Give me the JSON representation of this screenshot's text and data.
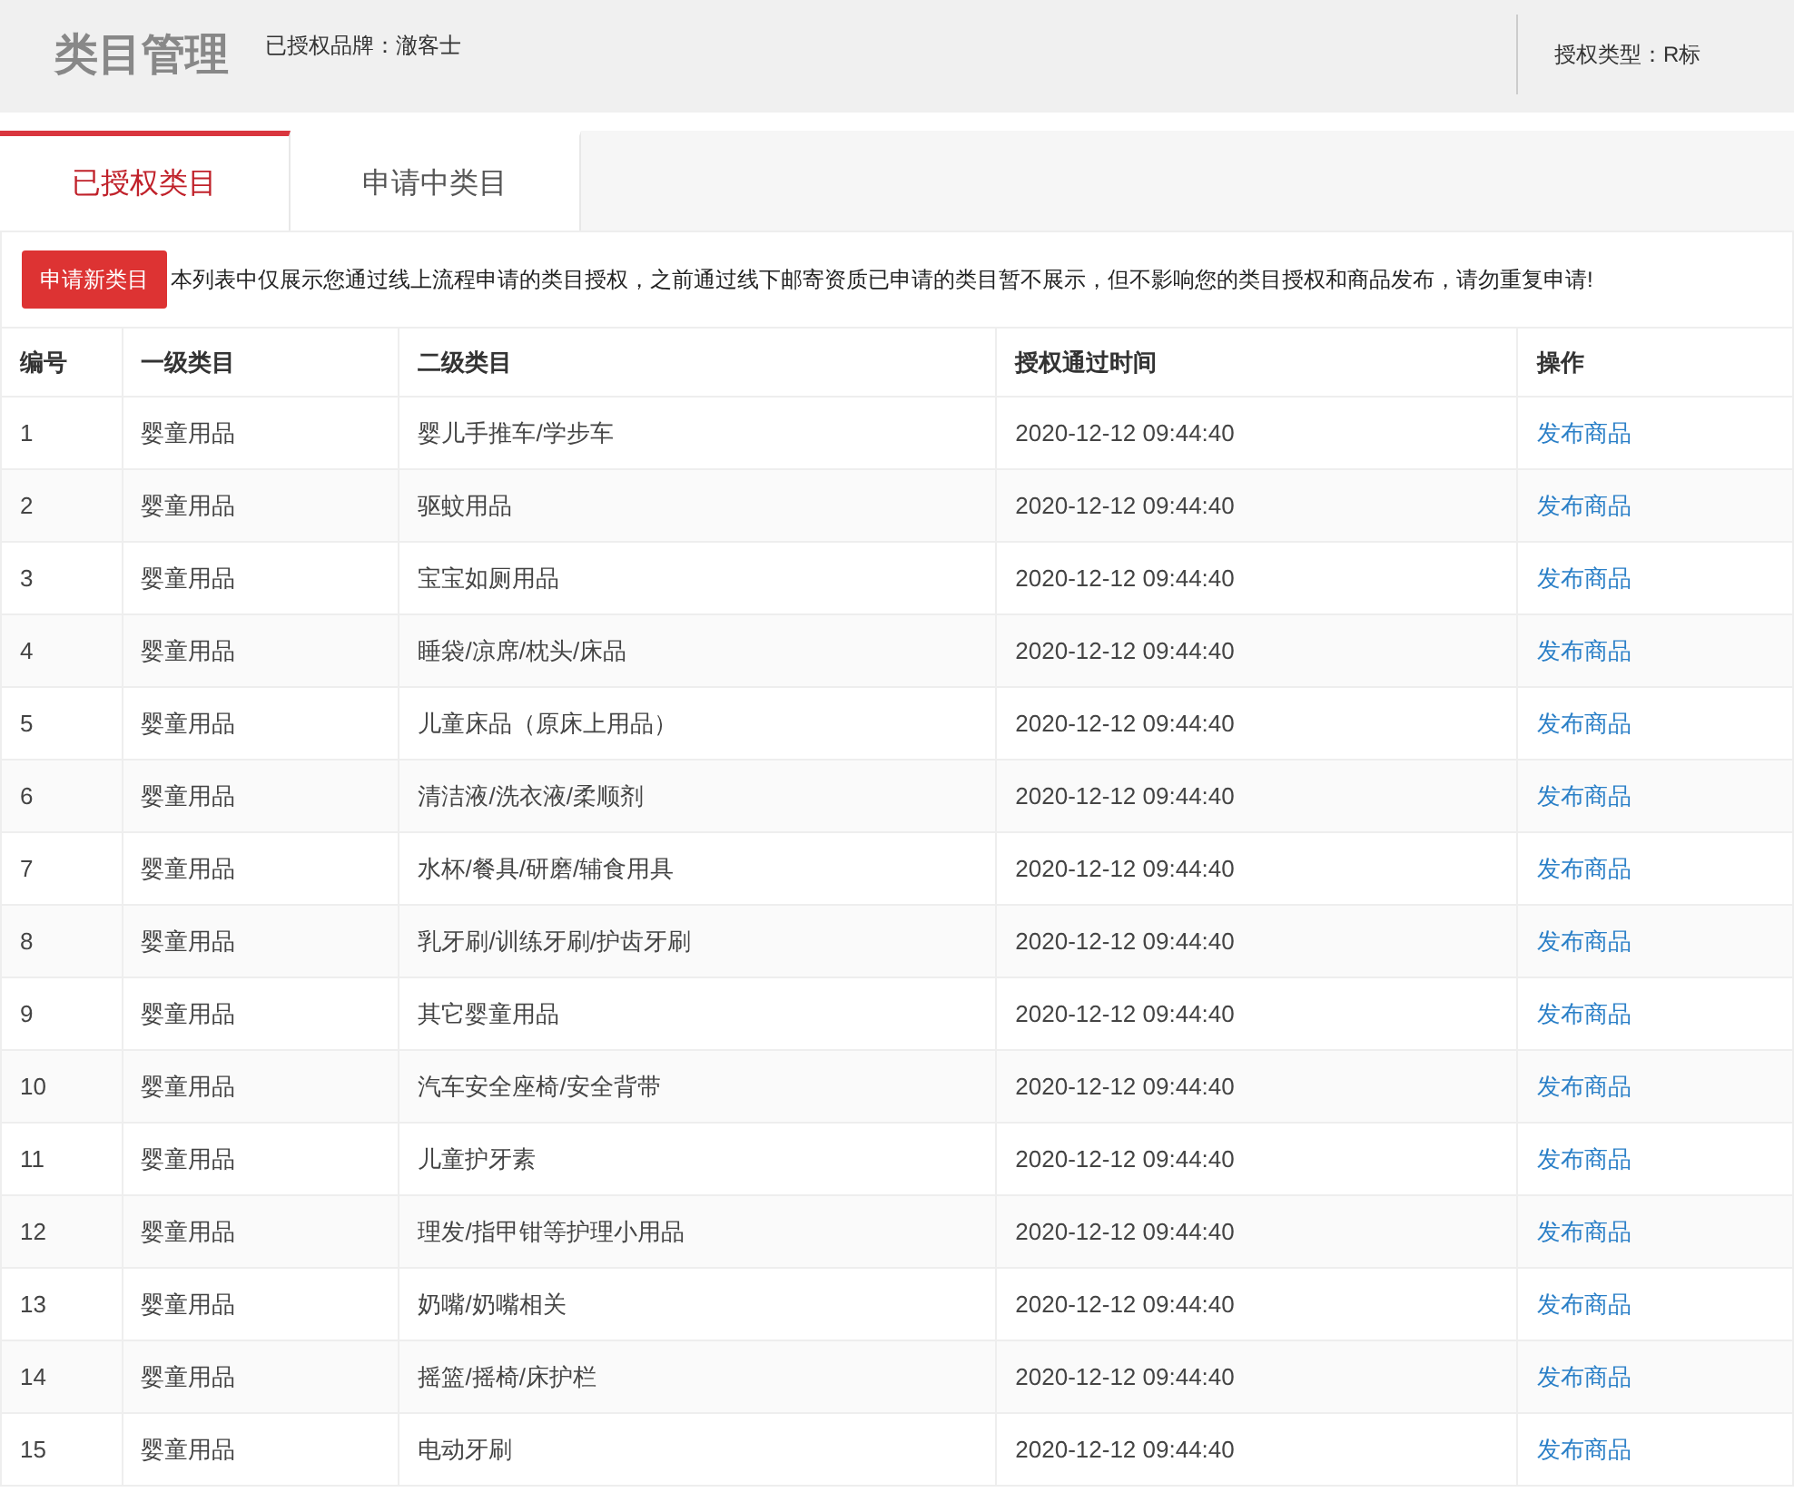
{
  "header": {
    "title": "类目管理",
    "brand_label": "已授权品牌：",
    "brand": "澈客士",
    "auth_type_label": "授权类型：",
    "auth_type": "R标"
  },
  "tabs": [
    {
      "label": "已授权类目",
      "selected": true
    },
    {
      "label": "申请中类目",
      "selected": false
    }
  ],
  "apply_button": "申请新类目",
  "notice": "本列表中仅展示您通过线上流程申请的类目授权，之前通过线下邮寄资质已申请的类目暂不展示，但不影响您的类目授权和商品发布，请勿重复申请!",
  "table": {
    "columns": [
      "编号",
      "一级类目",
      "二级类目",
      "授权通过时间",
      "操作"
    ],
    "rows": [
      {
        "no": "1",
        "cat1": "婴童用品",
        "cat2": "婴儿手推车/学步车",
        "time": "2020-12-12 09:44:40",
        "action": "发布商品"
      },
      {
        "no": "2",
        "cat1": "婴童用品",
        "cat2": "驱蚊用品",
        "time": "2020-12-12 09:44:40",
        "action": "发布商品"
      },
      {
        "no": "3",
        "cat1": "婴童用品",
        "cat2": "宝宝如厕用品",
        "time": "2020-12-12 09:44:40",
        "action": "发布商品"
      },
      {
        "no": "4",
        "cat1": "婴童用品",
        "cat2": "睡袋/凉席/枕头/床品",
        "time": "2020-12-12 09:44:40",
        "action": "发布商品"
      },
      {
        "no": "5",
        "cat1": "婴童用品",
        "cat2": "儿童床品（原床上用品）",
        "time": "2020-12-12 09:44:40",
        "action": "发布商品"
      },
      {
        "no": "6",
        "cat1": "婴童用品",
        "cat2": "清洁液/洗衣液/柔顺剂",
        "time": "2020-12-12 09:44:40",
        "action": "发布商品"
      },
      {
        "no": "7",
        "cat1": "婴童用品",
        "cat2": "水杯/餐具/研磨/辅食用具",
        "time": "2020-12-12 09:44:40",
        "action": "发布商品"
      },
      {
        "no": "8",
        "cat1": "婴童用品",
        "cat2": "乳牙刷/训练牙刷/护齿牙刷",
        "time": "2020-12-12 09:44:40",
        "action": "发布商品"
      },
      {
        "no": "9",
        "cat1": "婴童用品",
        "cat2": "其它婴童用品",
        "time": "2020-12-12 09:44:40",
        "action": "发布商品"
      },
      {
        "no": "10",
        "cat1": "婴童用品",
        "cat2": "汽车安全座椅/安全背带",
        "time": "2020-12-12 09:44:40",
        "action": "发布商品"
      },
      {
        "no": "11",
        "cat1": "婴童用品",
        "cat2": "儿童护牙素",
        "time": "2020-12-12 09:44:40",
        "action": "发布商品"
      },
      {
        "no": "12",
        "cat1": "婴童用品",
        "cat2": "理发/指甲钳等护理小用品",
        "time": "2020-12-12 09:44:40",
        "action": "发布商品"
      },
      {
        "no": "13",
        "cat1": "婴童用品",
        "cat2": "奶嘴/奶嘴相关",
        "time": "2020-12-12 09:44:40",
        "action": "发布商品"
      },
      {
        "no": "14",
        "cat1": "婴童用品",
        "cat2": "摇篮/摇椅/床护栏",
        "time": "2020-12-12 09:44:40",
        "action": "发布商品"
      },
      {
        "no": "15",
        "cat1": "婴童用品",
        "cat2": "电动牙刷",
        "time": "2020-12-12 09:44:40",
        "action": "发布商品"
      }
    ]
  }
}
